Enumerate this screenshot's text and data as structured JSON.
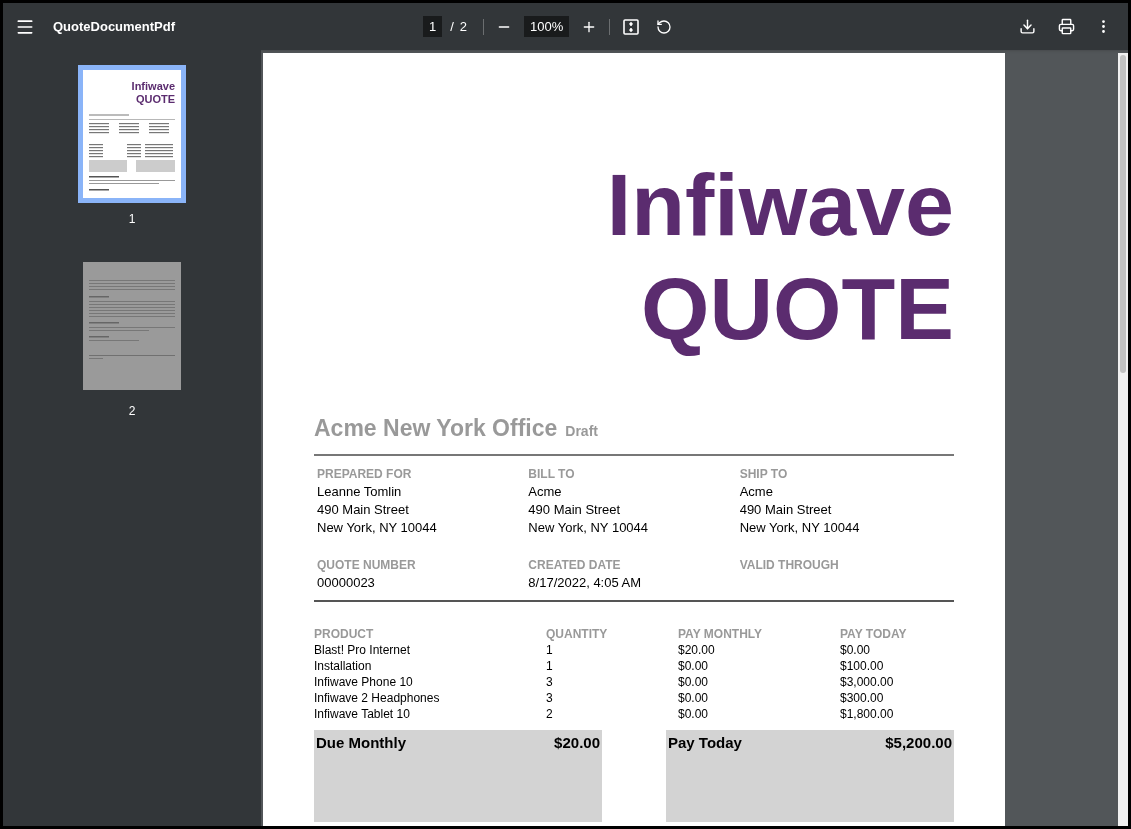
{
  "toolbar": {
    "title": "QuoteDocumentPdf",
    "page": "1",
    "page_count": "2",
    "separator": "/",
    "zoom": "100%"
  },
  "thumbnails": [
    {
      "number": "1",
      "selected": true,
      "title_lines": [
        "Infiwave",
        "QUOTE"
      ]
    },
    {
      "number": "2",
      "selected": false
    }
  ],
  "document": {
    "title_lines": [
      "Infiwave",
      "QUOTE"
    ],
    "office": "Acme New York Office",
    "status": "Draft",
    "address_blocks": [
      {
        "label": "PREPARED FOR",
        "lines": [
          "Leanne Tomlin",
          "490 Main Street",
          "New York, NY 10044"
        ]
      },
      {
        "label": "BILL TO",
        "lines": [
          "Acme",
          "490 Main Street",
          "New York, NY 10044"
        ]
      },
      {
        "label": "SHIP TO",
        "lines": [
          "Acme",
          "490 Main Street",
          "New York, NY 10044"
        ]
      }
    ],
    "info_blocks": [
      {
        "label": "QUOTE NUMBER",
        "value": "00000023"
      },
      {
        "label": "CREATED DATE",
        "value": "8/17/2022, 4:05 AM"
      },
      {
        "label": "VALID THROUGH"
      }
    ],
    "table": {
      "columns": [
        "PRODUCT",
        "QUANTITY",
        "PAY MONTHLY",
        "PAY TODAY"
      ],
      "rows": [
        [
          "Blast! Pro Internet",
          "1",
          "$20.00",
          "$0.00"
        ],
        [
          "Installation",
          "1",
          "$0.00",
          "$100.00"
        ],
        [
          "Infiwave Phone 10",
          "3",
          "$0.00",
          "$3,000.00"
        ],
        [
          "Infiwave 2 Headphones",
          "3",
          "$0.00",
          "$300.00"
        ],
        [
          "Infiwave Tablet 10",
          "2",
          "$0.00",
          "$1,800.00"
        ]
      ]
    },
    "totals": [
      {
        "label": "Due Monthly",
        "value": "$20.00"
      },
      {
        "label": "Pay Today",
        "value": "$5,200.00"
      }
    ]
  }
}
